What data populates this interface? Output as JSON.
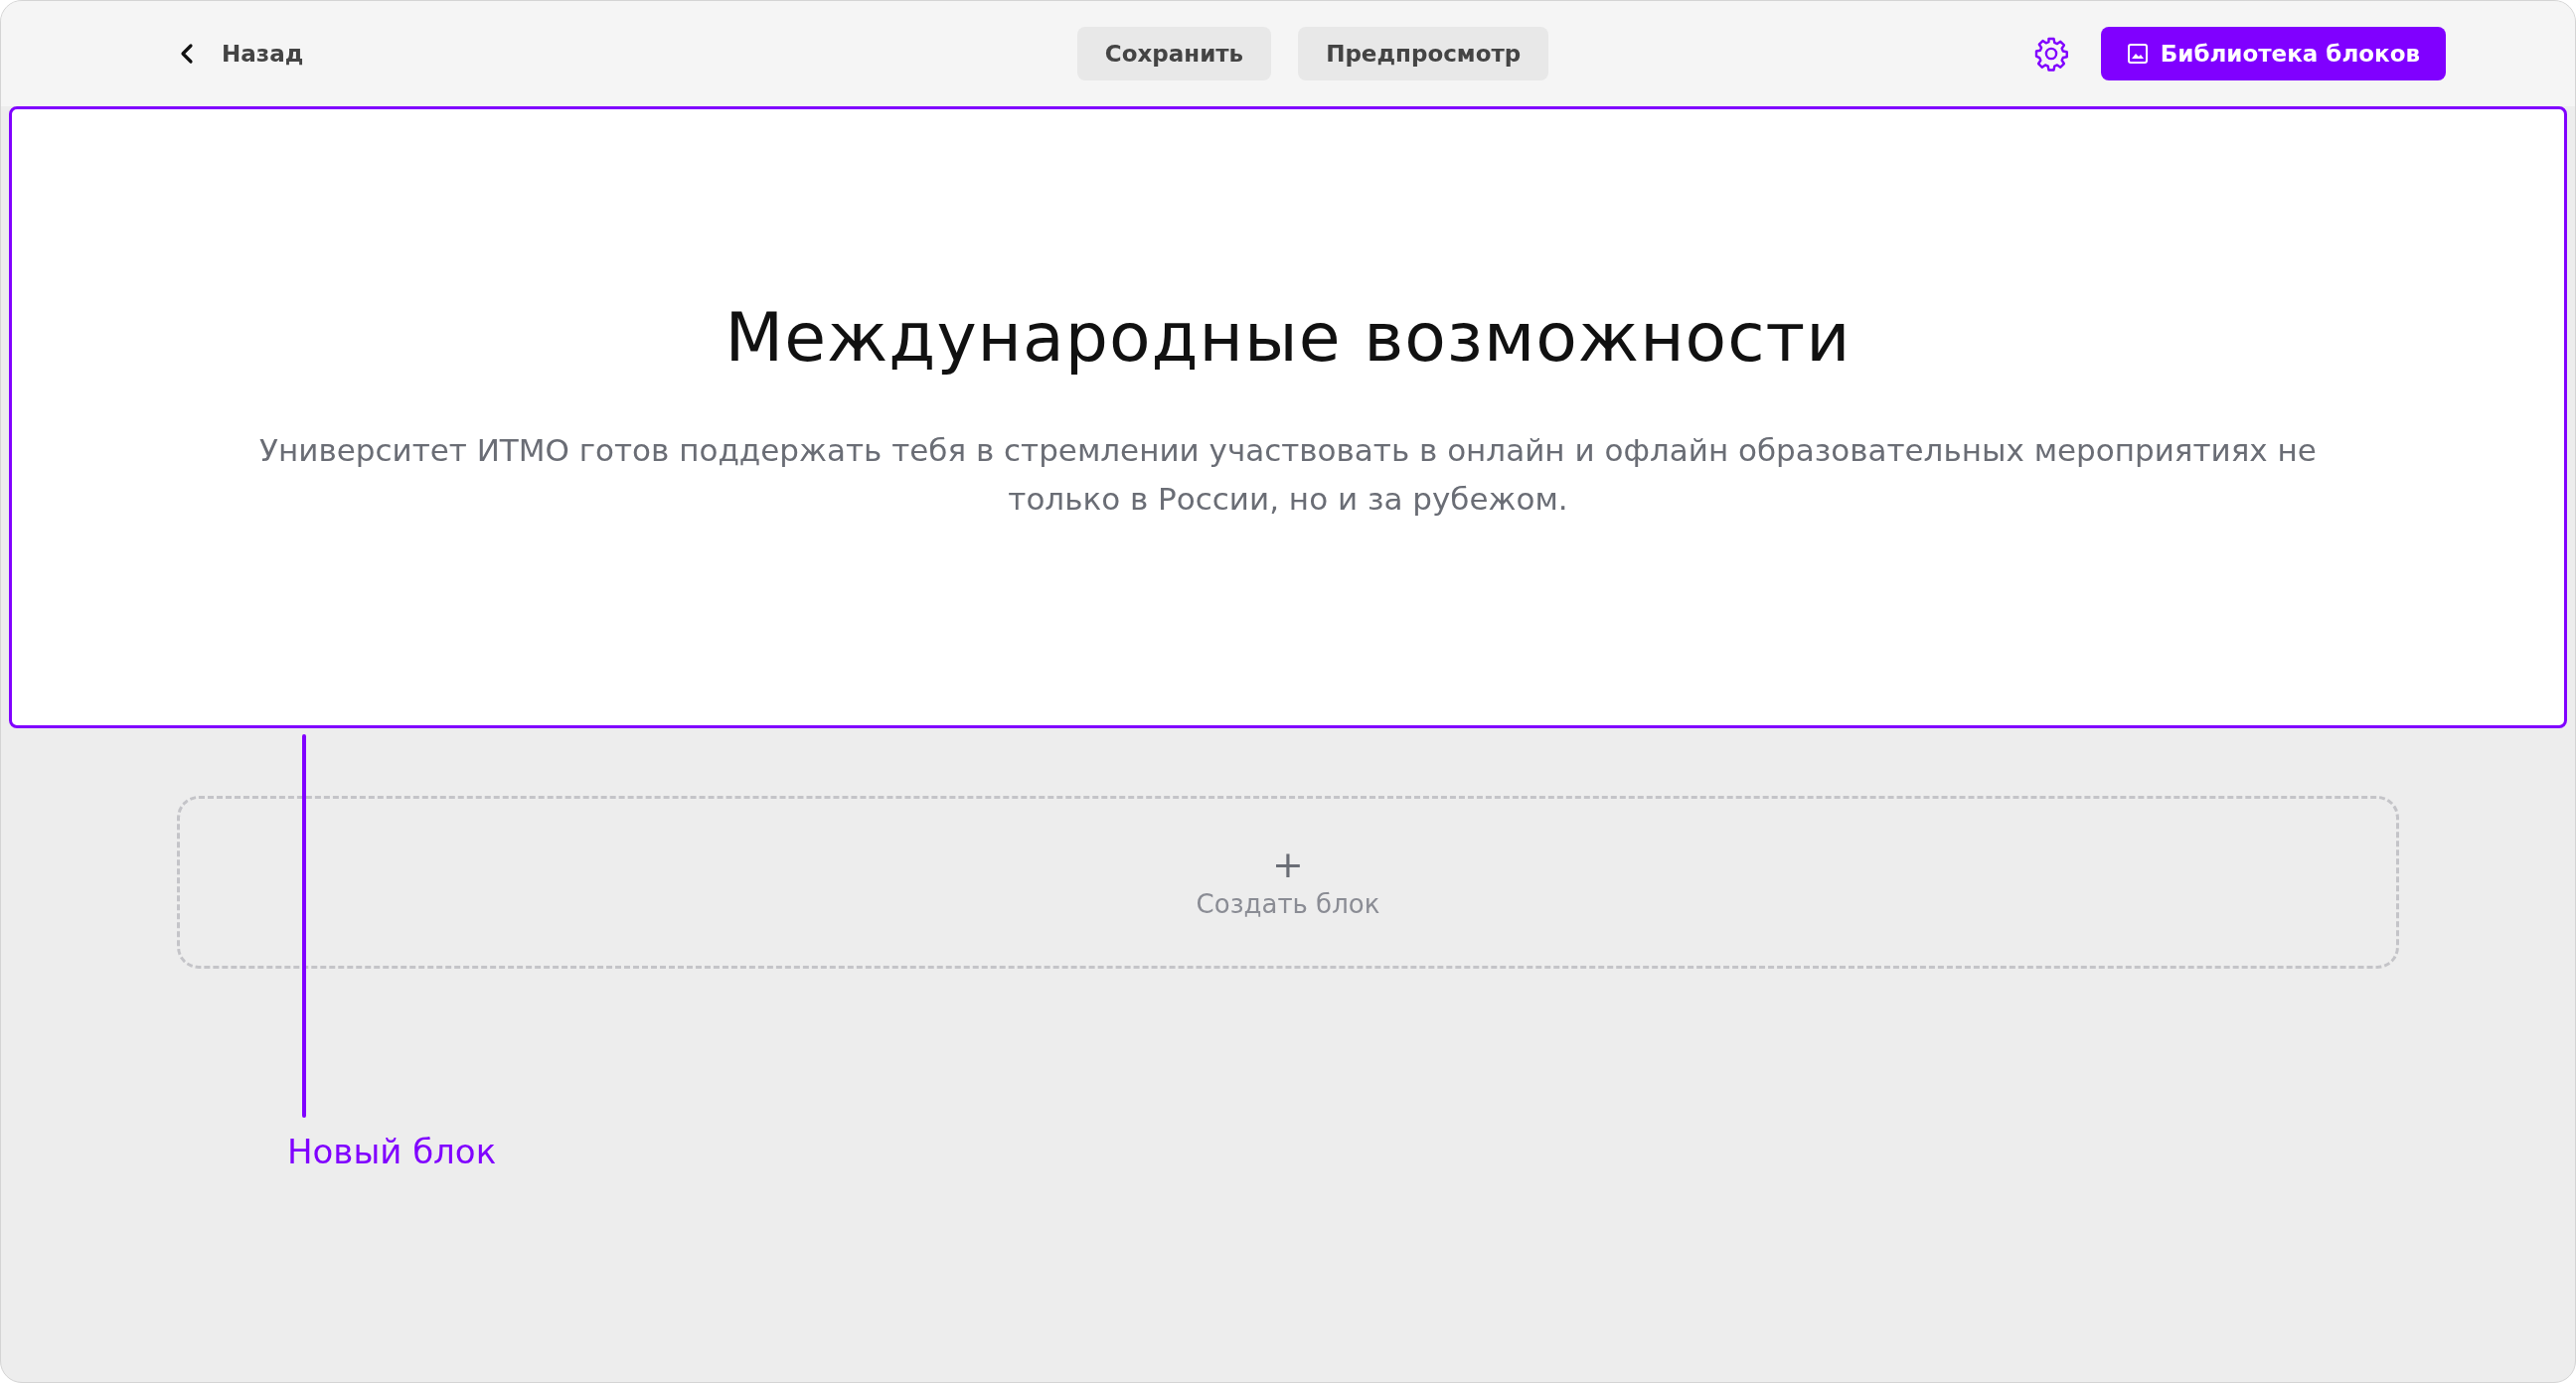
{
  "toolbar": {
    "back": "Назад",
    "save": "Сохранить",
    "preview": "Предпросмотр",
    "library": "Библиотека блоков"
  },
  "hero": {
    "selected": true,
    "title": "Международные возможности",
    "text": "Университет ИТМО готов поддержать тебя в стремлении участвовать в онлайн и офлайн образовательных мероприятиях не только в России, но и за рубежом."
  },
  "create_block": {
    "icon": "+",
    "label": "Создать блок"
  },
  "annotation": "Новый блок"
}
